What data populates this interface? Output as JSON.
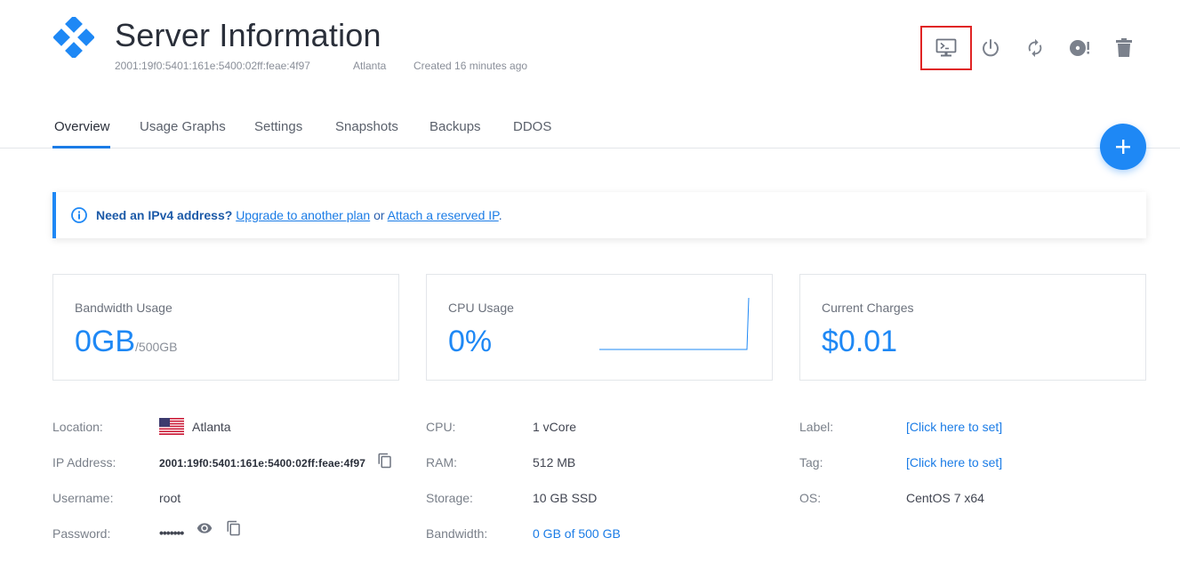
{
  "header": {
    "title": "Server Information",
    "ip": "2001:19f0:5401:161e:5400:02ff:feae:4f97",
    "location": "Atlanta",
    "created": "Created 16 minutes ago",
    "logo_icon": "vultr-diamond-logo",
    "actions": [
      {
        "name": "view-console",
        "icon": "console-monitor-icon",
        "highlighted": true
      },
      {
        "name": "power",
        "icon": "power-icon",
        "highlighted": false
      },
      {
        "name": "restart",
        "icon": "refresh-icon",
        "highlighted": false
      },
      {
        "name": "reinstall",
        "icon": "disc-alert-icon",
        "highlighted": false
      },
      {
        "name": "destroy",
        "icon": "trash-icon",
        "highlighted": false
      }
    ]
  },
  "tabs": [
    {
      "label": "Overview",
      "active": true
    },
    {
      "label": "Usage Graphs",
      "active": false
    },
    {
      "label": "Settings",
      "active": false
    },
    {
      "label": "Snapshots",
      "active": false
    },
    {
      "label": "Backups",
      "active": false
    },
    {
      "label": "DDOS",
      "active": false
    }
  ],
  "fab": {
    "label": "+"
  },
  "notice": {
    "bold": "Need an IPv4 address?",
    "link1": "Upgrade to another plan",
    "middle": " or ",
    "link2": "Attach a reserved IP",
    "end": "."
  },
  "cards": {
    "bandwidth": {
      "label": "Bandwidth Usage",
      "value": "0GB",
      "suffix": "/500GB"
    },
    "cpu": {
      "label": "CPU Usage",
      "value": "0%"
    },
    "charges": {
      "label": "Current Charges",
      "value": "$0.01"
    }
  },
  "details": {
    "location_label": "Location:",
    "location_value": "Atlanta",
    "ip_label": "IP Address:",
    "ip_value": "2001:19f0:5401:161e:5400:02ff:feae:4f97",
    "username_label": "Username:",
    "username_value": "root",
    "password_label": "Password:",
    "password_value": "•••••••",
    "cpu_label": "CPU:",
    "cpu_value": "1 vCore",
    "ram_label": "RAM:",
    "ram_value": "512 MB",
    "storage_label": "Storage:",
    "storage_value": "10 GB SSD",
    "bandwidth_label": "Bandwidth:",
    "bandwidth_value": "0 GB of 500 GB",
    "label_label": "Label:",
    "label_value": "[Click here to set]",
    "tag_label": "Tag:",
    "tag_value": "[Click here to set]",
    "os_label": "OS:",
    "os_value": "CentOS 7 x64"
  },
  "colors": {
    "accent": "#1e88f5",
    "highlight_border": "#e02424",
    "icon_gray": "#7b818c"
  }
}
